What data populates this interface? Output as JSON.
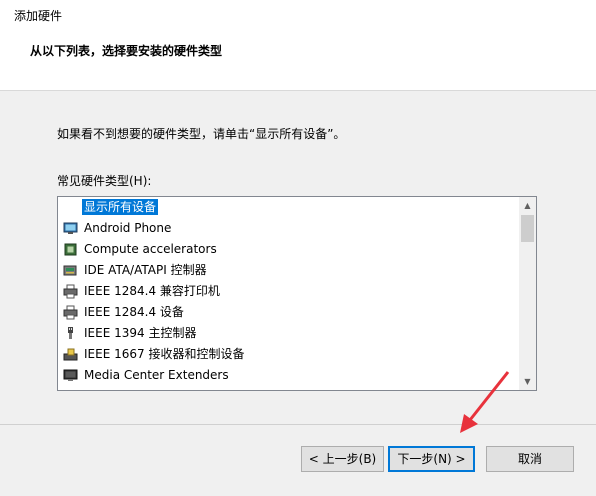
{
  "window": {
    "title": "添加硬件"
  },
  "header": {
    "heading": "从以下列表，选择要安装的硬件类型"
  },
  "main": {
    "instruction": "如果看不到想要的硬件类型，请单击“显示所有设备”。",
    "list_label": "常见硬件类型(H):",
    "hardware_types": [
      {
        "label": "显示所有设备",
        "selected": true,
        "icon": "none"
      },
      {
        "label": "Android Phone",
        "selected": false,
        "icon": "phone-monitor-icon"
      },
      {
        "label": "Compute accelerators",
        "selected": false,
        "icon": "chip-icon"
      },
      {
        "label": "IDE ATA/ATAPI 控制器",
        "selected": false,
        "icon": "ide-controller-icon"
      },
      {
        "label": "IEEE 1284.4 兼容打印机",
        "selected": false,
        "icon": "printer-icon"
      },
      {
        "label": "IEEE 1284.4 设备",
        "selected": false,
        "icon": "printer-icon"
      },
      {
        "label": "IEEE 1394 主控制器",
        "selected": false,
        "icon": "usb-plug-icon"
      },
      {
        "label": "IEEE 1667 接收器和控制设备",
        "selected": false,
        "icon": "reader-icon"
      },
      {
        "label": "Media Center Extenders",
        "selected": false,
        "icon": "monitor-icon"
      }
    ]
  },
  "buttons": {
    "back": "< 上一步(B)",
    "next": "下一步(N) >",
    "cancel": "取消"
  },
  "colors": {
    "selection": "#0078d7",
    "default_button_border": "#0078d7",
    "annotation_arrow": "#e8323c"
  }
}
